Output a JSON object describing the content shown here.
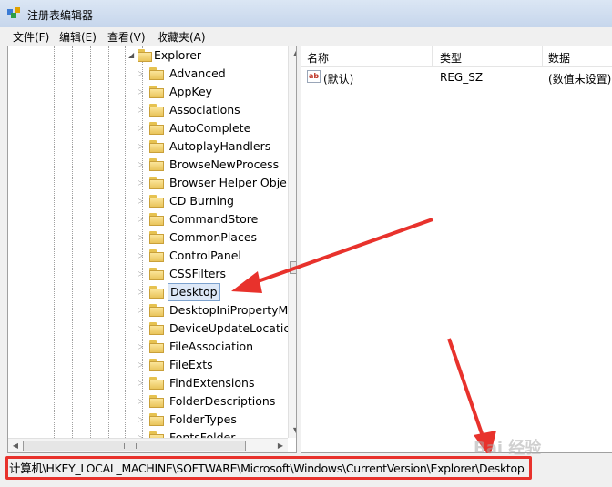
{
  "window": {
    "title": "注册表编辑器",
    "icon": "registry-editor-icon"
  },
  "menu": [
    {
      "label": "文件(F)"
    },
    {
      "label": "编辑(E)"
    },
    {
      "label": "查看(V)"
    },
    {
      "label": "收藏夹(A)"
    }
  ],
  "tree": {
    "parent": "Explorer",
    "children": [
      {
        "label": "Advanced"
      },
      {
        "label": "AppKey"
      },
      {
        "label": "Associations"
      },
      {
        "label": "AutoComplete"
      },
      {
        "label": "AutoplayHandlers"
      },
      {
        "label": "BrowseNewProcess"
      },
      {
        "label": "Browser Helper Obje"
      },
      {
        "label": "CD Burning"
      },
      {
        "label": "CommandStore"
      },
      {
        "label": "CommonPlaces"
      },
      {
        "label": "ControlPanel"
      },
      {
        "label": "CSSFilters"
      },
      {
        "label": "Desktop",
        "selected": true
      },
      {
        "label": "DesktopIniPropertyM"
      },
      {
        "label": "DeviceUpdateLocatic"
      },
      {
        "label": "FileAssociation"
      },
      {
        "label": "FileExts"
      },
      {
        "label": "FindExtensions"
      },
      {
        "label": "FolderDescriptions"
      },
      {
        "label": "FolderTypes"
      },
      {
        "label": "FontsFolder"
      }
    ]
  },
  "list": {
    "columns": [
      "名称",
      "类型",
      "数据"
    ],
    "rows": [
      {
        "name": "(默认)",
        "type": "REG_SZ",
        "data": "(数值未设置)",
        "icon": "string-value-icon"
      }
    ]
  },
  "status": {
    "path": "计算机\\HKEY_LOCAL_MACHINE\\SOFTWARE\\Microsoft\\Windows\\CurrentVersion\\Explorer\\Desktop"
  },
  "watermark": "Bai 经验",
  "colors": {
    "annotation_red": "#e8322c",
    "selection_bg": "#dde8f7",
    "selection_border": "#7da2ce"
  }
}
